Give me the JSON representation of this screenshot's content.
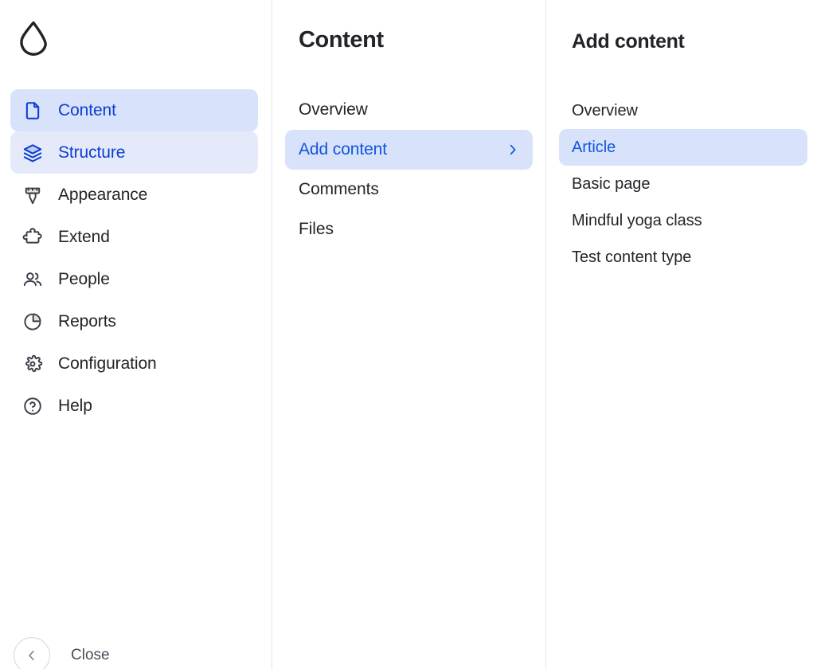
{
  "brand": {
    "logo_icon": "drupal-droplet-logo"
  },
  "colors": {
    "accent_blue": "#0b3ed1",
    "link_blue": "#1155e0",
    "active_strong_bg": "#d8e2fb",
    "active_soft_bg": "#e5eafb",
    "text_dark": "#232429",
    "divider": "#e6e6ea"
  },
  "sidebar": {
    "items": [
      {
        "label": "Content",
        "icon": "document-icon",
        "state": "active-strong"
      },
      {
        "label": "Structure",
        "icon": "layers-icon",
        "state": "active-soft"
      },
      {
        "label": "Appearance",
        "icon": "paint-brush-icon",
        "state": "default"
      },
      {
        "label": "Extend",
        "icon": "puzzle-piece-icon",
        "state": "default"
      },
      {
        "label": "People",
        "icon": "people-icon",
        "state": "default"
      },
      {
        "label": "Reports",
        "icon": "pie-chart-icon",
        "state": "default"
      },
      {
        "label": "Configuration",
        "icon": "gear-icon",
        "state": "default"
      },
      {
        "label": "Help",
        "icon": "question-mark-circle-icon",
        "state": "default"
      }
    ],
    "close": {
      "label": "Close",
      "icon": "chevron-left-icon"
    }
  },
  "panel_content": {
    "title": "Content",
    "items": [
      {
        "label": "Overview",
        "selected": false,
        "has_chevron": false
      },
      {
        "label": "Add content",
        "selected": true,
        "has_chevron": true
      },
      {
        "label": "Comments",
        "selected": false,
        "has_chevron": false
      },
      {
        "label": "Files",
        "selected": false,
        "has_chevron": false
      }
    ]
  },
  "panel_add_content": {
    "title": "Add content",
    "items": [
      {
        "label": "Overview",
        "selected": false
      },
      {
        "label": "Article",
        "selected": true
      },
      {
        "label": "Basic page",
        "selected": false
      },
      {
        "label": "Mindful yoga class",
        "selected": false
      },
      {
        "label": "Test content type",
        "selected": false
      }
    ]
  }
}
